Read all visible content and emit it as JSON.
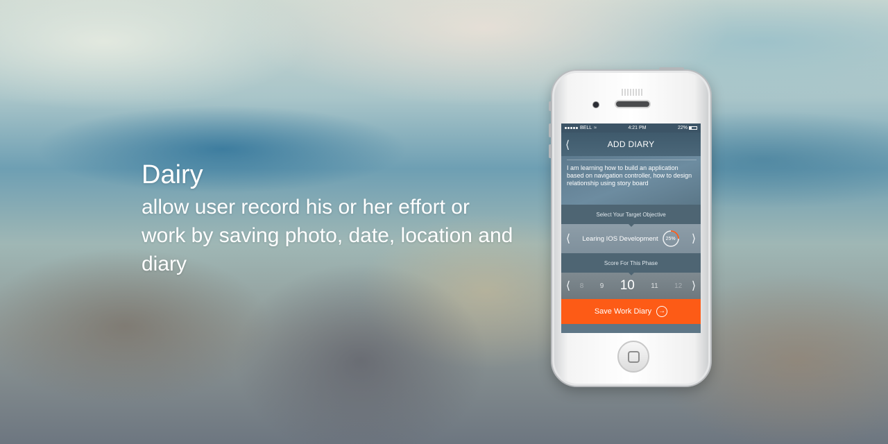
{
  "headline": {
    "title": "Dairy",
    "description": "allow user record his or her effort or work by saving photo, date, location and diary"
  },
  "phone": {
    "status_bar": {
      "carrier": "BELL",
      "time": "4:21 PM",
      "battery": "22%"
    },
    "nav": {
      "back_icon": "chevron-left-icon",
      "title": "ADD DIARY"
    },
    "diary_text": "I am learning how to build an application based on navigation controller, how to design relationship using story board",
    "objective": {
      "label": "Select Your Target Objective",
      "name": "Learing IOS Development",
      "progress_text": "25%",
      "progress": 0.25
    },
    "score": {
      "label": "Score For This Phase",
      "values": [
        "8",
        "9",
        "10",
        "11",
        "12"
      ],
      "selected": "10"
    },
    "save_button": {
      "label": "Save Work Diary",
      "icon": "arrow-right-circle-icon"
    }
  },
  "colors": {
    "accent": "#fd5b16",
    "progress_ring": "#fd5b16",
    "nav_bar": "#3f5a6c"
  }
}
